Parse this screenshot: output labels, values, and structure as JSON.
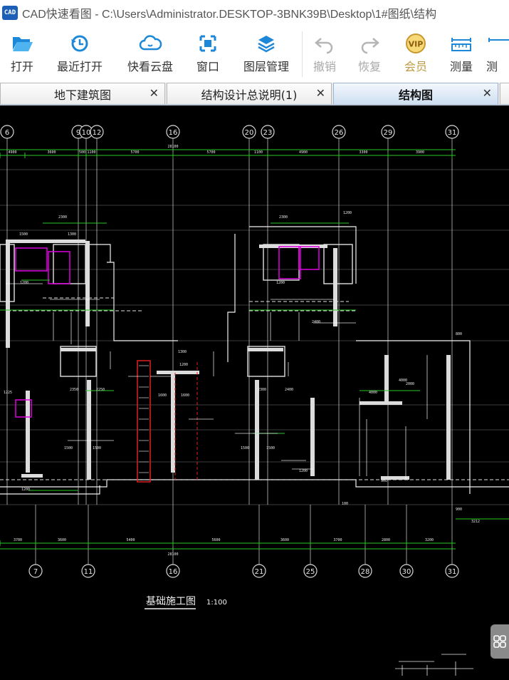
{
  "window": {
    "logo_text": "CAD",
    "title": "CAD快速看图 - C:\\Users\\Administrator.DESKTOP-3BNK39B\\Desktop\\1#图纸\\结构"
  },
  "toolbar": {
    "open": "打开",
    "recent": "最近打开",
    "cloud": "快看云盘",
    "window": "窗口",
    "layers": "图层管理",
    "undo": "撤销",
    "redo": "恢复",
    "vip_badge": "VIP",
    "vip": "会员",
    "measure": "测量",
    "measure2": "测"
  },
  "tabs": [
    {
      "label": "地下建筑图",
      "close": "✕",
      "active": false
    },
    {
      "label": "结构设计总说明(1)",
      "close": "✕",
      "active": false
    },
    {
      "label": "结构图",
      "close": "✕",
      "active": true
    }
  ],
  "drawing": {
    "title": "基础施工图",
    "scale": "1:100",
    "top_axes": [
      "6",
      "9",
      "10",
      "12",
      "16",
      "20",
      "23",
      "26",
      "29",
      "31"
    ],
    "bottom_axes": [
      "7",
      "11",
      "16",
      "21",
      "25",
      "28",
      "30",
      "31"
    ],
    "top_dims": [
      "4900",
      "3600",
      "500",
      "1100",
      "5700",
      "5700",
      "1100",
      "4900",
      "3300",
      "3900"
    ],
    "bottom_dims": [
      "3700",
      "3600",
      "5400",
      "5600",
      "3600",
      "3700",
      "2800",
      "3200"
    ],
    "overall_dim_top": "28100",
    "overall_dim_bottom": "28100",
    "right_dim": "3212"
  },
  "colors": {
    "axis_line": "#d8d8d8",
    "dim_line": "#28c828",
    "wall": "#ffffff",
    "magenta": "#e000e0",
    "red": "#e02020"
  }
}
